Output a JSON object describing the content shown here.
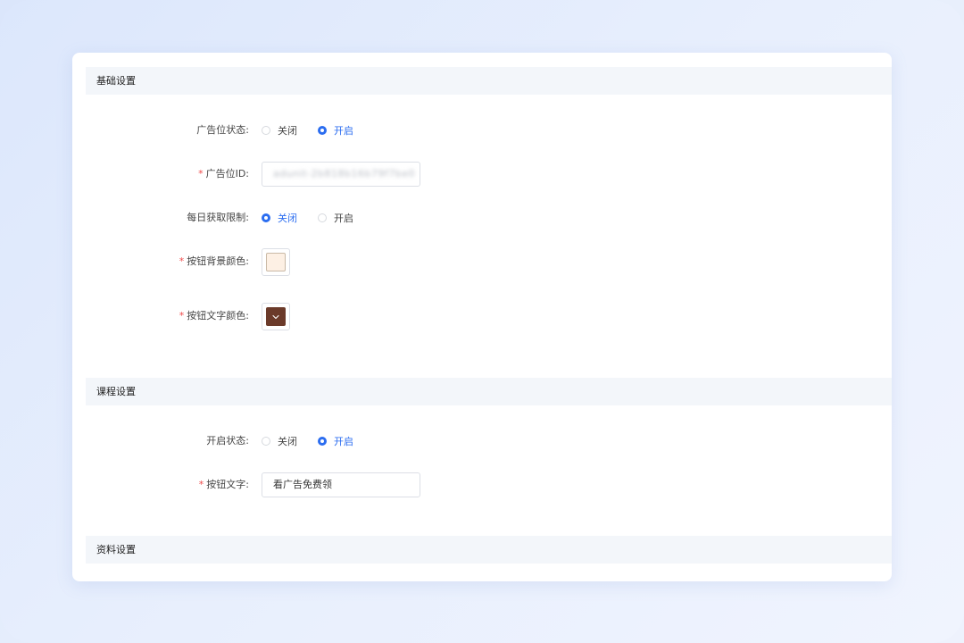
{
  "sections": [
    {
      "title": "基础设置"
    },
    {
      "title": "课程设置"
    },
    {
      "title": "资料设置"
    }
  ],
  "basic": {
    "ad_status": {
      "label": "广告位状态:",
      "options": [
        "关闭",
        "开启"
      ],
      "selected": "开启"
    },
    "ad_id": {
      "label": "广告位ID:",
      "required": "*",
      "value": "adunit-2b818b16b79f7be0"
    },
    "daily_limit": {
      "label": "每日获取限制:",
      "options": [
        "关闭",
        "开启"
      ],
      "selected": "关闭"
    },
    "button_bg_color": {
      "label": "按钮背景颜色:",
      "required": "*",
      "color": "#fdf0e4"
    },
    "button_text_color": {
      "label": "按钮文字颜色:",
      "required": "*",
      "color": "#6b3a2a"
    }
  },
  "course": {
    "open_status": {
      "label": "开启状态:",
      "options": [
        "关闭",
        "开启"
      ],
      "selected": "开启"
    },
    "button_text": {
      "label": "按钮文字:",
      "required": "*",
      "value": "看广告免费领"
    }
  },
  "theme": {
    "accent": "#2b6df0",
    "required_mark": "#f04a4a",
    "section_bg": "#f3f6fa"
  }
}
